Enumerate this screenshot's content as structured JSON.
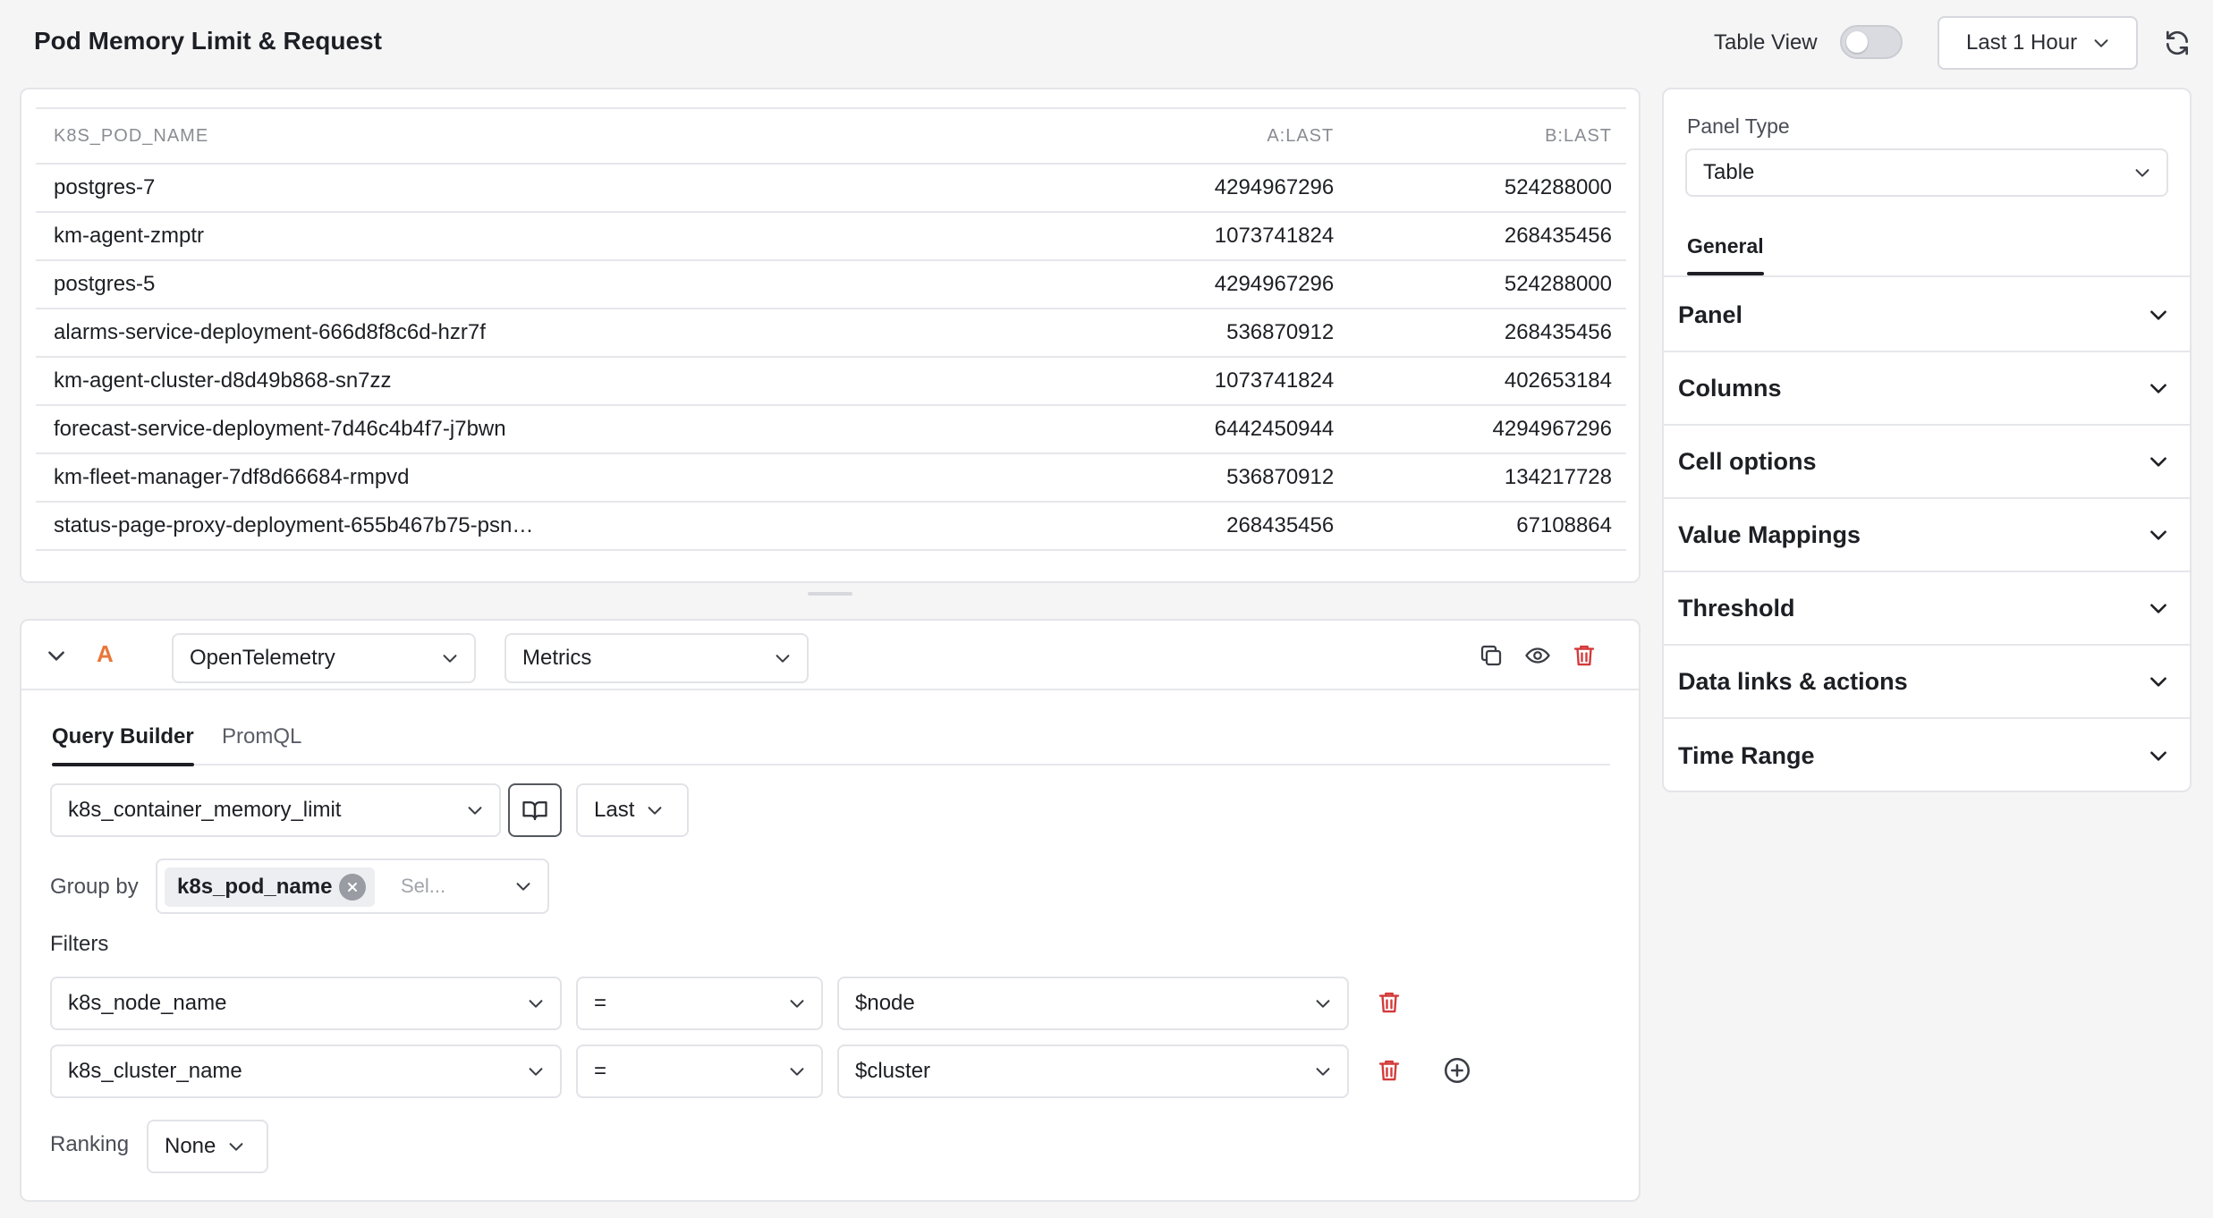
{
  "header": {
    "title": "Pod Memory Limit & Request",
    "table_view_label": "Table View",
    "table_view_enabled": false,
    "time_range": "Last 1 Hour"
  },
  "table": {
    "columns": [
      "K8S_POD_NAME",
      "A:LAST",
      "B:LAST"
    ],
    "rows": [
      [
        "postgres-7",
        "4294967296",
        "524288000"
      ],
      [
        "km-agent-zmptr",
        "1073741824",
        "268435456"
      ],
      [
        "postgres-5",
        "4294967296",
        "524288000"
      ],
      [
        "alarms-service-deployment-666d8f8c6d-hzr7f",
        "536870912",
        "268435456"
      ],
      [
        "km-agent-cluster-d8d49b868-sn7zz",
        "1073741824",
        "402653184"
      ],
      [
        "forecast-service-deployment-7d46c4b4f7-j7bwn",
        "6442450944",
        "4294967296"
      ],
      [
        "km-fleet-manager-7df8d66684-rmpvd",
        "536870912",
        "134217728"
      ],
      [
        "status-page-proxy-deployment-655b467b75-psn…",
        "268435456",
        "67108864"
      ]
    ]
  },
  "query": {
    "letter": "A",
    "source": "OpenTelemetry",
    "signal": "Metrics",
    "tabs": [
      "Query Builder",
      "PromQL"
    ],
    "metric": "k8s_container_memory_limit",
    "aggregation": "Last",
    "group_by_label": "Group by",
    "group_by_chip": "k8s_pod_name",
    "group_by_placeholder": "Sel...",
    "filters_label": "Filters",
    "filters": [
      {
        "key": "k8s_node_name",
        "op": "=",
        "value": "$node"
      },
      {
        "key": "k8s_cluster_name",
        "op": "=",
        "value": "$cluster"
      }
    ],
    "ranking_label": "Ranking",
    "ranking_value": "None"
  },
  "settings": {
    "panel_type_label": "Panel Type",
    "panel_type_value": "Table",
    "tab": "General",
    "sections": [
      "Panel",
      "Columns",
      "Cell options",
      "Value Mappings",
      "Threshold",
      "Data links & actions",
      "Time Range"
    ]
  },
  "icons": {
    "refresh": "refresh-icon",
    "copy": "copy-icon",
    "eye": "eye-icon",
    "trash": "trash-icon",
    "book": "book-icon",
    "plus": "plus-circle-icon",
    "chevron": "chevron-down-icon"
  },
  "colors": {
    "accent_orange": "#e8783a",
    "danger": "#d33a3a"
  }
}
